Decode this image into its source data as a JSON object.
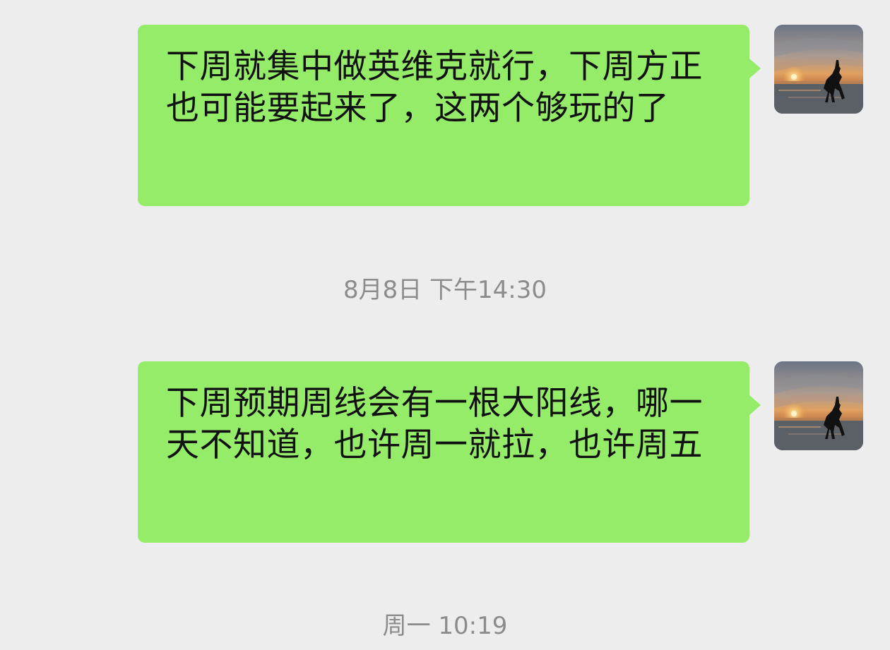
{
  "messages": [
    {
      "text": "下周就集中做英维克就行，下周方正也可能要起来了，这两个够玩的了",
      "sender": "self",
      "avatar_icon": "sunset-horse-avatar-icon"
    },
    {
      "text": "下周预期周线会有一根大阳线，哪一天不知道，也许周一就拉，也许周五",
      "sender": "self",
      "avatar_icon": "sunset-horse-avatar-icon"
    }
  ],
  "timestamps": [
    "8月8日 下午14:30",
    "周一 10:19"
  ],
  "colors": {
    "background": "#ededed",
    "bubble": "#95ec69",
    "timestamp_text": "#8c8c8c"
  }
}
